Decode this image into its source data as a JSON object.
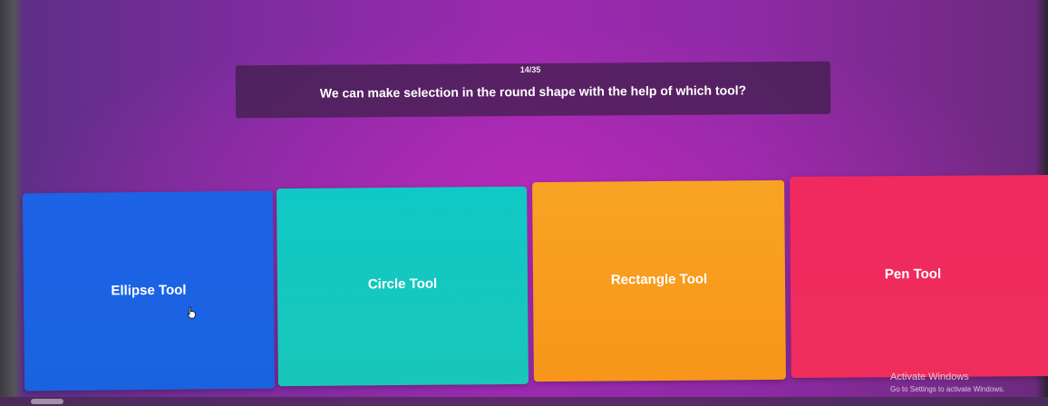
{
  "quiz": {
    "counter": "14/35",
    "question": "We can make selection in the round shape with the help of which tool?"
  },
  "answers": [
    {
      "label": "Ellipse Tool",
      "color": "#1c63e6"
    },
    {
      "label": "Circle Tool",
      "color": "#10c9c6"
    },
    {
      "label": "Rectangle Tool",
      "color": "#f8a323"
    },
    {
      "label": "Pen Tool",
      "color": "#f0295f"
    }
  ],
  "windows_watermark": {
    "title": "Activate Windows",
    "subtitle": "Go to Settings to activate Windows."
  },
  "icons": {
    "pointer": "hand-pointer-icon"
  }
}
